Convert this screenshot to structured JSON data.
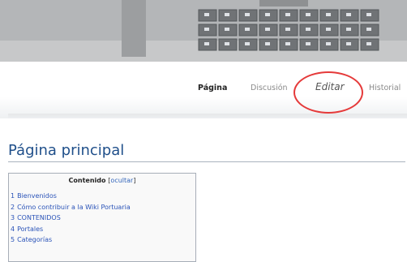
{
  "tabs": {
    "pagina": "Página",
    "discusion": "Discusión",
    "editar": "Editar",
    "historial": "Historial"
  },
  "main": {
    "title": "Página principal"
  },
  "toc": {
    "heading": "Contenido",
    "toggle_open": "[",
    "toggle_label": "ocultar",
    "toggle_close": "]",
    "items": [
      {
        "num": "1",
        "label": "Bienvenidos"
      },
      {
        "num": "2",
        "label": "Cómo contribuir a la Wiki Portuaria"
      },
      {
        "num": "3",
        "label": "CONTENIDOS"
      },
      {
        "num": "4",
        "label": "Portales"
      },
      {
        "num": "5",
        "label": "Categorías"
      }
    ]
  },
  "colors": {
    "link": "#2a53b8",
    "title": "#1f4f8a",
    "highlight": "#e53a3a"
  }
}
